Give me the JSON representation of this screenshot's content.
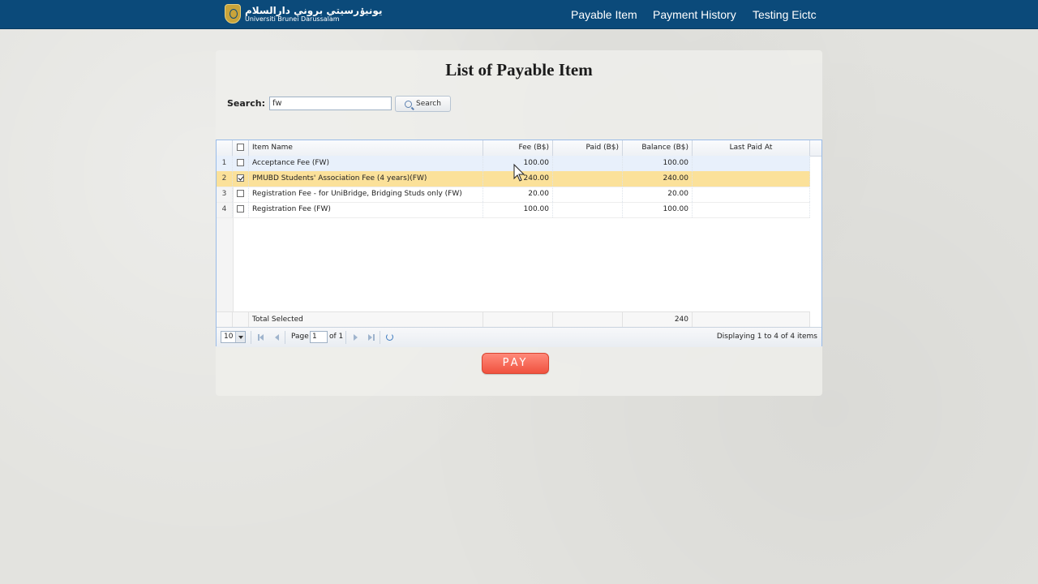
{
  "header": {
    "logo_arabic": "يونيۏرسيتي بروني دارالسلام",
    "logo_english": "Universiti Brunei Darussalam",
    "nav": [
      "Payable Item",
      "Payment History",
      "Testing Eictc"
    ]
  },
  "page": {
    "title": "List of Payable Item",
    "search_label": "Search:",
    "search_value": "fw",
    "search_button": "Search"
  },
  "grid": {
    "columns": [
      "Item Name",
      "Fee (B$)",
      "Paid (B$)",
      "Balance (B$)",
      "Last Paid At"
    ],
    "rows": [
      {
        "num": "1",
        "checked": false,
        "name": "Acceptance Fee (FW)",
        "fee": "100.00",
        "paid": "",
        "balance": "100.00",
        "last": ""
      },
      {
        "num": "2",
        "checked": true,
        "name": "PMUBD Students' Association Fee (4 years)(FW)",
        "fee": "240.00",
        "paid": "",
        "balance": "240.00",
        "last": ""
      },
      {
        "num": "3",
        "checked": false,
        "name": "Registration Fee - for UniBridge, Bridging Studs only (FW)",
        "fee": "20.00",
        "paid": "",
        "balance": "20.00",
        "last": ""
      },
      {
        "num": "4",
        "checked": false,
        "name": "Registration Fee (FW)",
        "fee": "100.00",
        "paid": "",
        "balance": "100.00",
        "last": ""
      }
    ],
    "summary_label": "Total Selected",
    "summary_balance": "240"
  },
  "pager": {
    "page_size": "10",
    "page_label": "Page",
    "page_value": "1",
    "of_label": "of 1",
    "display_text": "Displaying 1 to 4 of 4 items"
  },
  "pay_button": "PAY",
  "colors": {
    "header_bg": "#0b4a7a",
    "selected_row": "#fbe19a",
    "pay_button": "#f0523f"
  }
}
